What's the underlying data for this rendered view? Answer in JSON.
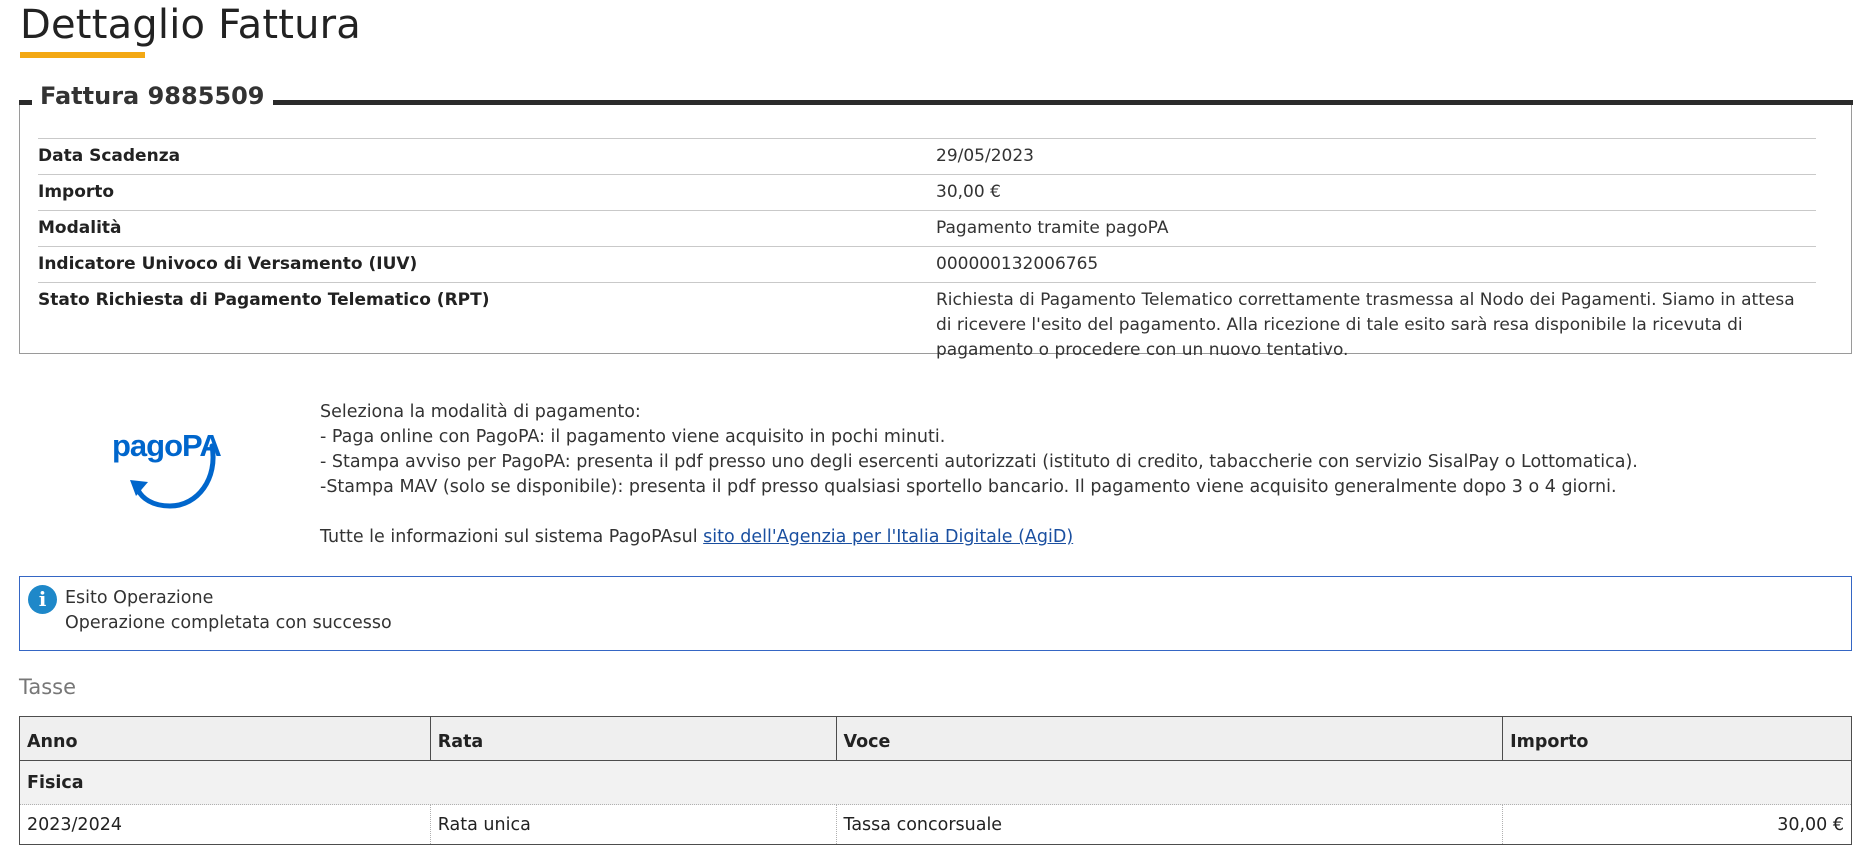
{
  "page": {
    "title": "Dettaglio Fattura"
  },
  "fattura": {
    "legend": "Fattura 9885509",
    "rows": [
      {
        "label": "Data Scadenza",
        "value": "29/05/2023"
      },
      {
        "label": "Importo",
        "value": "30,00 €"
      },
      {
        "label": "Modalità",
        "value": "Pagamento tramite pagoPA"
      },
      {
        "label": "Indicatore Univoco di Versamento (IUV)",
        "value": "000000132006765"
      },
      {
        "label": "Stato Richiesta di Pagamento Telematico (RPT)",
        "value": "Richiesta di Pagamento Telematico correttamente trasmessa al Nodo dei Pagamenti. Siamo in attesa di ricevere l'esito del pagamento. Alla ricezione di tale esito sarà resa disponibile la ricevuta di pagamento o procedere con un nuovo tentativo."
      }
    ]
  },
  "pagopa": {
    "logo_text": "pagoPA",
    "intro": "Seleziona la modalità di pagamento:",
    "options": [
      "- Paga online con PagoPA: il pagamento viene acquisito in pochi minuti.",
      "- Stampa avviso per PagoPA: presenta il pdf presso uno degli esercenti autorizzati (istituto di credito, tabaccherie con servizio SisalPay o Lottomatica).",
      "-Stampa MAV (solo se disponibile): presenta il pdf presso qualsiasi sportello bancario. Il pagamento viene acquisito generalmente dopo 3 o 4 giorni."
    ],
    "info_prefix": "Tutte le informazioni sul sistema PagoPAsul ",
    "info_link": "sito dell'Agenzia per l'Italia Digitale (AgiD)"
  },
  "alert": {
    "icon": "info-icon",
    "title": "Esito Operazione",
    "message": "Operazione completata con successo"
  },
  "tasse": {
    "title": "Tasse",
    "headers": [
      "Anno",
      "Rata",
      "Voce",
      "Importo"
    ],
    "group": "Fisica",
    "rows": [
      {
        "anno": "2023/2024",
        "rata": "Rata unica",
        "voce": "Tassa concorsuale",
        "importo": "30,00 €"
      }
    ]
  },
  "colors": {
    "accent": "#f3a814",
    "pagopa_blue": "#0066cc",
    "alert_border": "#3566c4",
    "info_icon": "#1e88c9"
  }
}
